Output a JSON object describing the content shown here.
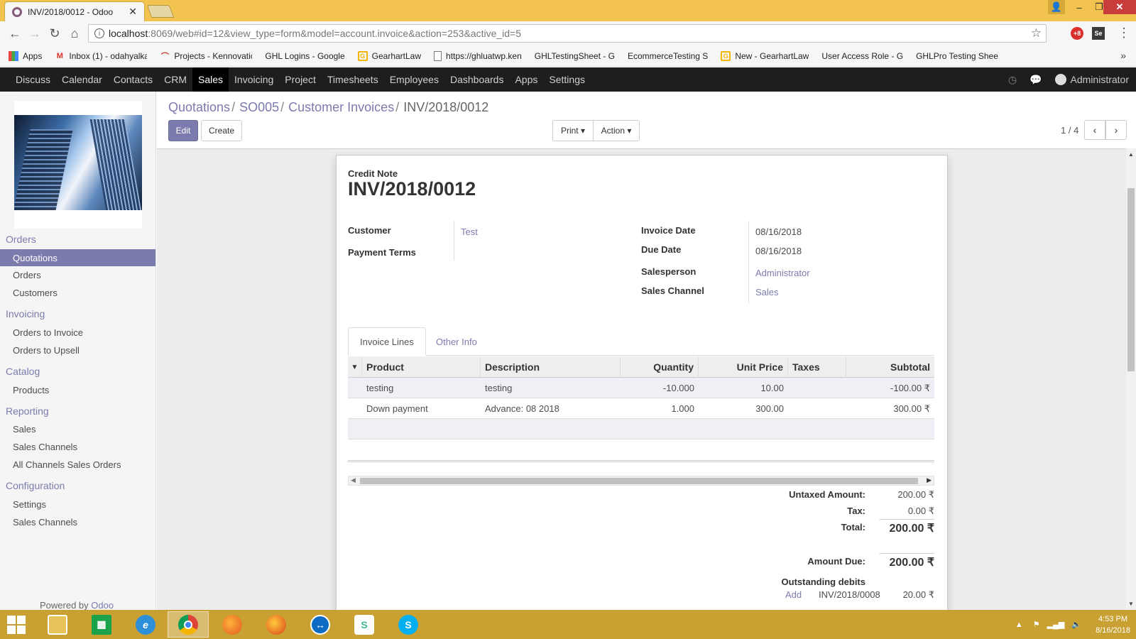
{
  "browser": {
    "tab_title": "INV/2018/0012 - Odoo",
    "url_host": "localhost",
    "url_path": ":8069/web#id=12&view_type=form&model=account.invoice&action=253&active_id=5",
    "bookmarks": [
      {
        "label": "Apps",
        "icon": "grid"
      },
      {
        "label": "Inbox (1) - odahyalka",
        "icon": "gmail"
      },
      {
        "label": "Projects - Kennovatic",
        "icon": "arc"
      },
      {
        "label": "GHL Logins - Google",
        "icon": "sheet"
      },
      {
        "label": "GearhartLaw",
        "icon": "g"
      },
      {
        "label": "https://ghluatwp.ken",
        "icon": "doc"
      },
      {
        "label": "GHLTestingSheet - G",
        "icon": "sheet"
      },
      {
        "label": "EcommerceTesting S",
        "icon": "sheet"
      },
      {
        "label": "New - GearhartLaw",
        "icon": "g"
      },
      {
        "label": "User Access Role - G",
        "icon": "sheet"
      },
      {
        "label": "GHLPro Testing Shee",
        "icon": "sheet"
      }
    ]
  },
  "topnav": {
    "items": [
      "Discuss",
      "Calendar",
      "Contacts",
      "CRM",
      "Sales",
      "Invoicing",
      "Project",
      "Timesheets",
      "Employees",
      "Dashboards",
      "Apps",
      "Settings"
    ],
    "active": "Sales",
    "user": "Administrator"
  },
  "sidebar": {
    "sections": [
      {
        "title": "Orders",
        "items": [
          "Quotations",
          "Orders",
          "Customers"
        ]
      },
      {
        "title": "Invoicing",
        "items": [
          "Orders to Invoice",
          "Orders to Upsell"
        ]
      },
      {
        "title": "Catalog",
        "items": [
          "Products"
        ]
      },
      {
        "title": "Reporting",
        "items": [
          "Sales",
          "Sales Channels",
          "All Channels Sales Orders"
        ]
      },
      {
        "title": "Configuration",
        "items": [
          "Settings",
          "Sales Channels"
        ]
      }
    ],
    "active_item": "Quotations",
    "powered_prefix": "Powered by ",
    "powered_brand": "Odoo"
  },
  "breadcrumb": [
    "Quotations",
    "SO005",
    "Customer Invoices",
    "INV/2018/0012"
  ],
  "buttons": {
    "edit": "Edit",
    "create": "Create",
    "print": "Print",
    "action": "Action"
  },
  "pager": "1 / 4",
  "form": {
    "doc_type": "Credit Note",
    "number": "INV/2018/0012",
    "customer_label": "Customer",
    "customer": "Test",
    "payment_terms_label": "Payment Terms",
    "invoice_date_label": "Invoice Date",
    "invoice_date": "08/16/2018",
    "due_date_label": "Due Date",
    "due_date": "08/16/2018",
    "salesperson_label": "Salesperson",
    "salesperson": "Administrator",
    "sales_channel_label": "Sales Channel",
    "sales_channel": "Sales",
    "tabs": [
      "Invoice Lines",
      "Other Info"
    ],
    "columns": [
      "Product",
      "Description",
      "Quantity",
      "Unit Price",
      "Taxes",
      "Subtotal"
    ],
    "lines": [
      {
        "product": "testing",
        "description": "testing",
        "quantity": "-10.000",
        "unit_price": "10.00",
        "taxes": "",
        "subtotal": "-100.00 ₹"
      },
      {
        "product": "Down payment",
        "description": "Advance: 08 2018",
        "quantity": "1.000",
        "unit_price": "300.00",
        "taxes": "",
        "subtotal": "300.00 ₹"
      }
    ],
    "totals": {
      "untaxed_label": "Untaxed Amount:",
      "untaxed": "200.00 ₹",
      "tax_label": "Tax:",
      "tax": "0.00 ₹",
      "total_label": "Total:",
      "total": "200.00 ₹",
      "due_label": "Amount Due:",
      "due": "200.00 ₹",
      "outstanding_label": "Outstanding debits",
      "outstanding_add": "Add",
      "outstanding_ref": "INV/2018/0008",
      "outstanding_amount": "20.00 ₹"
    }
  },
  "taskbar": {
    "time": "4:53 PM",
    "date": "8/16/2018"
  }
}
